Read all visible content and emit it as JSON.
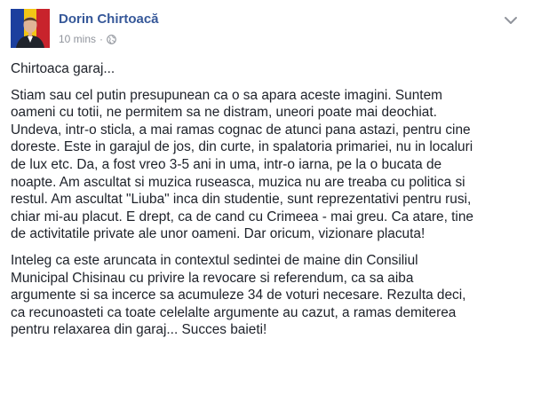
{
  "post": {
    "author": "Dorin Chirtoacă",
    "time": "10 mins",
    "separator": "·",
    "privacy_icon": "globe-icon",
    "more_icon": "chevron-down-icon",
    "paragraphs": [
      [
        "Chirtoaca garaj..."
      ],
      [
        "Stiam sau cel putin presupunean ca o sa apara aceste imagini. Suntem",
        "oameni cu totii, ne permitem sa ne distram, uneori poate mai deochiat.",
        "Undeva, intr-o sticla, a mai ramas cognac de atunci pana astazi, pentru cine",
        "doreste. Este in garajul de jos, din curte, in spalatoria primariei, nu in localuri",
        "de lux etc. Da, a fost vreo 3-5 ani in uma, intr-o iarna, pe la o bucata de",
        "noapte. Am ascultat si muzica ruseasca, muzica nu are treaba cu politica si",
        "restul. Am ascultat \"Liuba\" inca din studentie, sunt reprezentativi pentru rusi,",
        "chiar mi-au placut. E drept, ca de cand cu Crimeea - mai greu. Ca atare, tine",
        "de activitatile private ale unor oameni. Dar oricum, vizionare placuta!"
      ],
      [
        "Inteleg ca este aruncata in contextul sedintei de maine din Consiliul",
        "Municipal Chisinau cu privire la revocare si referendum, ca sa aiba",
        "argumente si sa incerce sa acumuleze 34 de voturi necesare. Rezulta deci,",
        "ca recunoasteti ca toate celelalte argumente au cazut, a ramas demiterea",
        "pentru relaxarea din garaj... Succes baieti!"
      ]
    ]
  },
  "colors": {
    "author": "#365899",
    "meta": "#90949c",
    "text": "#1d2129"
  }
}
